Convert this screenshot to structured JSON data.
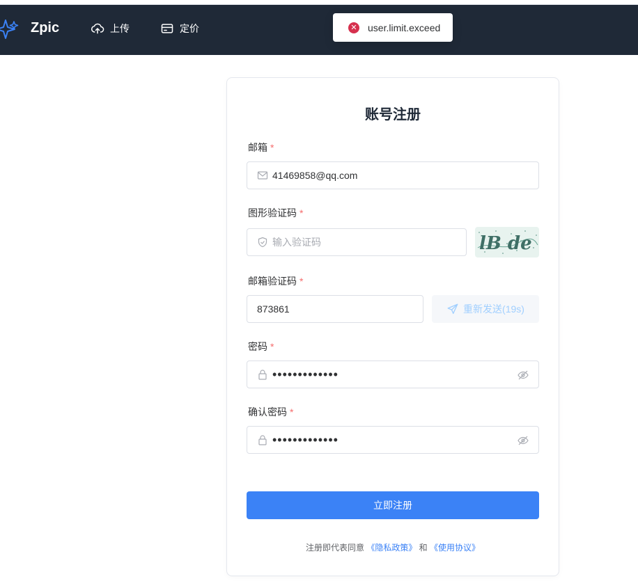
{
  "nav": {
    "brand": "Zpic",
    "upload_label": "上传",
    "pricing_label": "定价"
  },
  "toast": {
    "message": "user.limit.exceed",
    "type": "error",
    "color": "#d6304e"
  },
  "form": {
    "title": "账号注册",
    "required_mark": "*",
    "email": {
      "label": "邮箱",
      "value": "41469858@qq.com"
    },
    "captcha": {
      "label": "图形验证码",
      "placeholder": "输入验证码",
      "image_text": "lB de"
    },
    "email_code": {
      "label": "邮箱验证码",
      "value": "873861",
      "resend_label": "重新发送(19s)"
    },
    "password": {
      "label": "密码",
      "masked_value": "•••••••••••••"
    },
    "confirm_password": {
      "label": "确认密码",
      "masked_value": "•••••••••••••"
    },
    "submit_label": "立即注册",
    "agreement": {
      "prefix": "注册即代表同意",
      "privacy_link": "《隐私政策》",
      "conjunction": "和",
      "terms_link": "《使用协议》"
    }
  },
  "colors": {
    "navbar": "#1f2937",
    "primary": "#3b82f6",
    "required": "#f56c6c"
  }
}
